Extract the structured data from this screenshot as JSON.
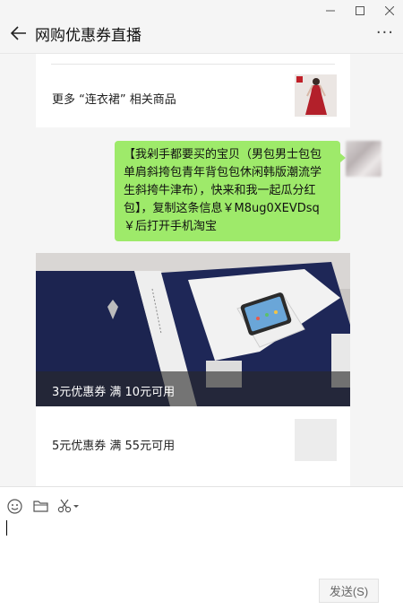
{
  "window": {
    "minimize_icon": "minimize-icon",
    "maximize_icon": "maximize-icon",
    "close_icon": "close-icon"
  },
  "header": {
    "back_icon": "arrow-left-icon",
    "title": "网购优惠券直播",
    "more_label": "···"
  },
  "messages": {
    "related_card": {
      "label": "更多 “连衣裙” 相关商品",
      "thumbnail": "red-dress-image"
    },
    "share_bubble": {
      "text": "【我剁手都要买的宝贝（男包男士包包单肩斜挎包青年背包包休闲韩版潮流学生斜挎牛津布），快来和我一起瓜分红包】，复制这条信息￥M8ug0XEVDsq￥后打开手机淘宝",
      "color": "#9eea6a"
    },
    "coupon_card": {
      "image": "navy-crossbody-bag-image",
      "caption": "3元优惠券 满 10元可用",
      "second_label": "5元优惠券 满 55元可用"
    }
  },
  "composer": {
    "emoji_icon": "emoji-icon",
    "folder_icon": "folder-icon",
    "scissors_icon": "scissors-icon",
    "send_label": "发送(S)"
  },
  "colors": {
    "bubble": "#9eea6a",
    "chat_bg": "#f5f5f5"
  }
}
